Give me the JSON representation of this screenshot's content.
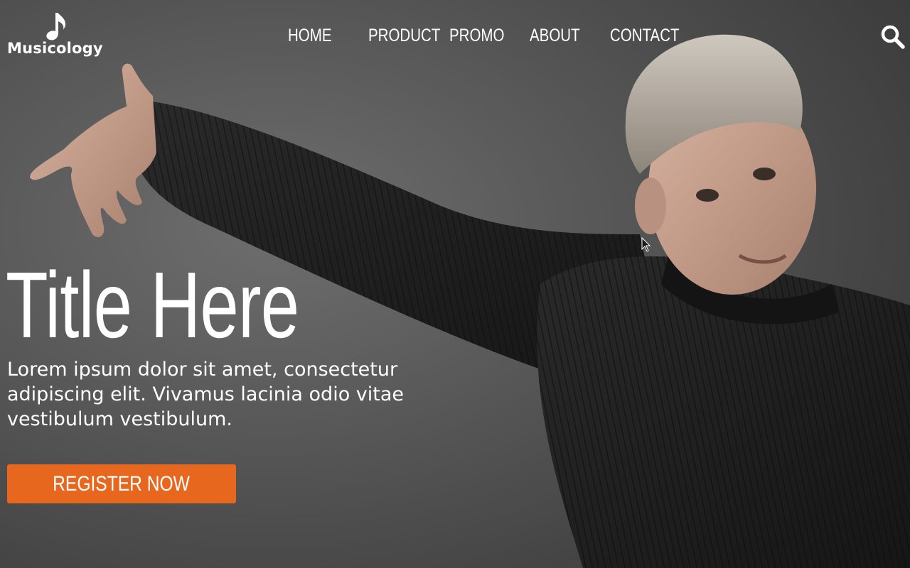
{
  "brand": {
    "name": "Musicology",
    "logo_icon": "music-note-icon"
  },
  "nav": {
    "items": [
      {
        "label": "HOME"
      },
      {
        "label": "PRODUCT"
      },
      {
        "label": "PROMO"
      },
      {
        "label": "ABOUT"
      },
      {
        "label": "CONTACT"
      }
    ],
    "search_icon": "search-icon"
  },
  "hero": {
    "title": "Title Here",
    "lead": "Lorem ipsum dolor sit amet, consectetur adipiscing elit. Vivamus lacinia odio vitae vestibulum vestibulum.",
    "cta_label": "REGISTER NOW",
    "image": "man-in-black-sweater-photo"
  },
  "colors": {
    "accent": "#e8671f",
    "text": "#ffffff",
    "background": "#4a4a4a"
  }
}
